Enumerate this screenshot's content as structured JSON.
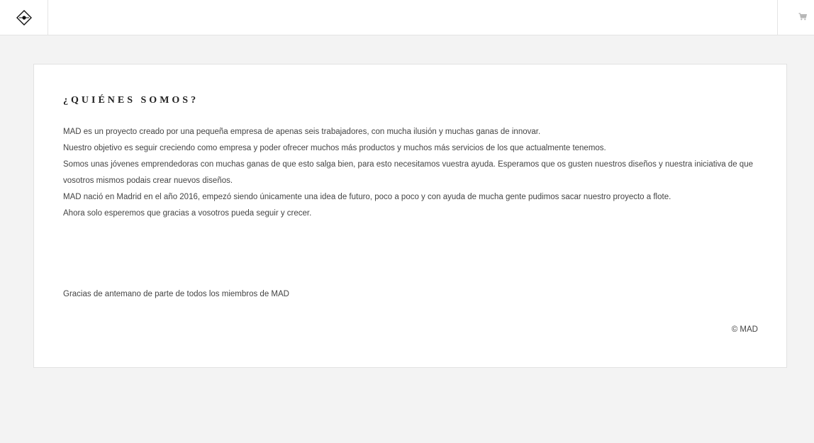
{
  "header": {
    "logo_icon": "diamond-dot-logo-icon",
    "cart_icon": "shopping-cart-icon"
  },
  "about": {
    "title": "¿QUIÉNES SOMOS?",
    "paragraphs": [
      "MAD es un proyecto creado por una pequeña empresa de apenas seis trabajadores, con mucha ilusión y muchas ganas de innovar.",
      "Nuestro objetivo es seguir creciendo como empresa y poder ofrecer muchos más productos y muchos más servicios de los que actualmente tenemos.",
      "Somos unas jóvenes emprendedoras con muchas ganas de que esto salga bien, para esto necesitamos vuestra ayuda. Esperamos que os gusten nuestros diseños y nuestra iniciativa de que vosotros mismos podais crear nuevos diseños.",
      "MAD nació en Madrid en el año 2016, empezó siendo únicamente una idea de futuro, poco a poco y con ayuda de mucha gente pudimos sacar nuestro proyecto a flote.",
      "Ahora solo esperemos que gracias a vosotros pueda seguir y crecer."
    ],
    "thanks": "Gracias de antemano de parte de todos los miembros de MAD",
    "copyright": "© MAD"
  }
}
